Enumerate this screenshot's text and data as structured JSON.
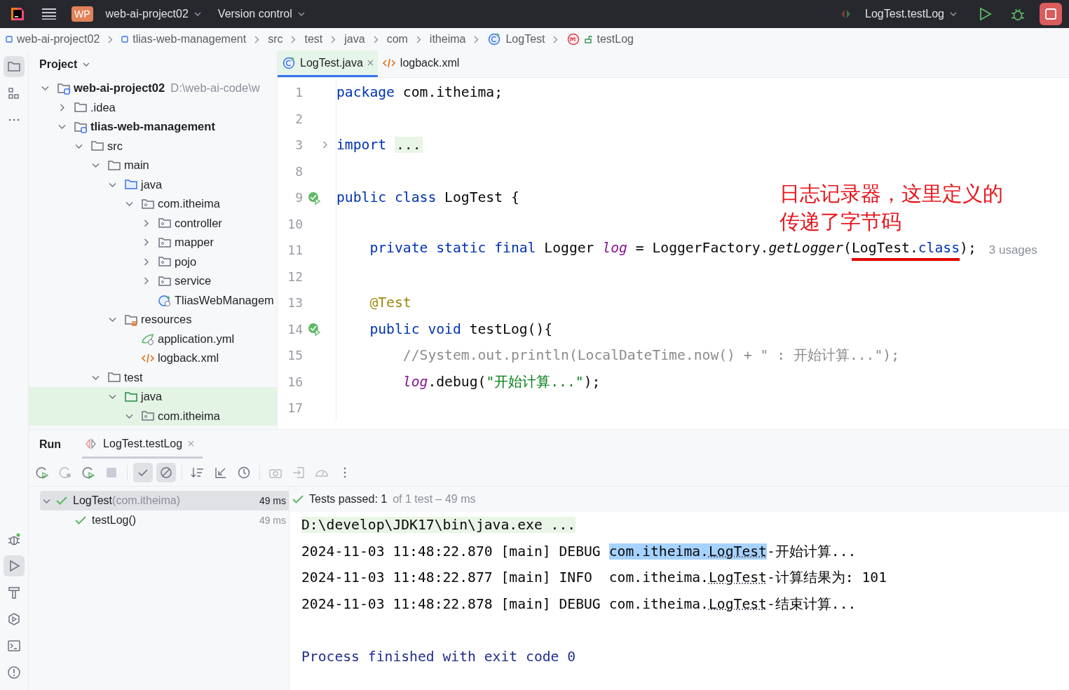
{
  "title_bar": {
    "project_badge": "WP",
    "project": "web-ai-project02",
    "vcs": "Version control",
    "run_config": "LogTest.testLog"
  },
  "breadcrumb": [
    {
      "label": "web-ai-project02",
      "kind": "module"
    },
    {
      "label": "tlias-web-management",
      "kind": "module"
    },
    {
      "label": "src",
      "kind": "plain"
    },
    {
      "label": "test",
      "kind": "plain"
    },
    {
      "label": "java",
      "kind": "plain"
    },
    {
      "label": "com",
      "kind": "plain"
    },
    {
      "label": "itheima",
      "kind": "plain"
    },
    {
      "label": "LogTest",
      "kind": "class"
    },
    {
      "label": "testLog",
      "kind": "method"
    }
  ],
  "project_panel": {
    "title": "Project",
    "tree": [
      {
        "label": "web-ai-project02",
        "hint": "D:\\web-ai-code\\w",
        "kind": "module",
        "bold": true,
        "expanded": true,
        "selected": false,
        "children": [
          {
            "label": ".idea",
            "kind": "folder",
            "bold": false,
            "expanded": false,
            "selected": false
          },
          {
            "label": "tlias-web-management",
            "kind": "module",
            "bold": true,
            "expanded": true,
            "selected": false,
            "children": [
              {
                "label": "src",
                "kind": "folder",
                "bold": false,
                "expanded": true,
                "selected": false,
                "children": [
                  {
                    "label": "main",
                    "kind": "folder",
                    "bold": false,
                    "expanded": true,
                    "selected": false,
                    "children": [
                      {
                        "label": "java",
                        "kind": "source",
                        "bold": false,
                        "expanded": true,
                        "selected": false,
                        "children": [
                          {
                            "label": "com.itheima",
                            "kind": "package",
                            "bold": false,
                            "expanded": true,
                            "selected": false,
                            "children": [
                              {
                                "label": "controller",
                                "kind": "package",
                                "bold": false,
                                "expanded": false,
                                "selected": false
                              },
                              {
                                "label": "mapper",
                                "kind": "package",
                                "bold": false,
                                "expanded": false,
                                "selected": false
                              },
                              {
                                "label": "pojo",
                                "kind": "package",
                                "bold": false,
                                "expanded": false,
                                "selected": false
                              },
                              {
                                "label": "service",
                                "kind": "package",
                                "bold": false,
                                "expanded": false,
                                "selected": false
                              },
                              {
                                "label": "TliasWebManagem",
                                "kind": "spring",
                                "bold": false,
                                "selected": false
                              }
                            ]
                          }
                        ]
                      },
                      {
                        "label": "resources",
                        "kind": "resources",
                        "bold": false,
                        "expanded": true,
                        "selected": false,
                        "children": [
                          {
                            "label": "application.yml",
                            "kind": "yml",
                            "bold": false,
                            "selected": false
                          },
                          {
                            "label": "logback.xml",
                            "kind": "xml",
                            "bold": false,
                            "selected": false
                          }
                        ]
                      }
                    ]
                  },
                  {
                    "label": "test",
                    "kind": "folder",
                    "bold": false,
                    "expanded": true,
                    "selected": false,
                    "children": [
                      {
                        "label": "java",
                        "kind": "testsource",
                        "bold": false,
                        "expanded": true,
                        "selected": true,
                        "children": [
                          {
                            "label": "com.itheima",
                            "kind": "package",
                            "bold": false,
                            "expanded": true,
                            "selected": true
                          }
                        ]
                      }
                    ]
                  }
                ]
              }
            ]
          }
        ]
      }
    ]
  },
  "editor": {
    "tabs": [
      {
        "label": "LogTest.java",
        "kind": "class",
        "selected": true,
        "closable": true
      },
      {
        "label": "logback.xml",
        "kind": "xml",
        "selected": false,
        "closable": false
      }
    ],
    "lines": [
      {
        "number": "1",
        "tokens": [
          {
            "kind": "keyword",
            "text": "package"
          },
          {
            "kind": "plain",
            "text": " com.itheima;"
          }
        ]
      },
      {
        "number": "2"
      },
      {
        "number": "3",
        "fold": true,
        "tokens": [
          {
            "kind": "keyword",
            "text": "import "
          },
          {
            "kind": "folded",
            "text": "..."
          }
        ]
      },
      {
        "number": "8"
      },
      {
        "number": "9",
        "run": true,
        "tokens": [
          {
            "kind": "keyword",
            "text": "public class"
          },
          {
            "kind": "plain",
            "text": " LogTest {"
          }
        ]
      },
      {
        "number": "10"
      },
      {
        "number": "11",
        "hint": "3 usages",
        "tokens": [
          {
            "kind": "keyword",
            "text": "    private static final"
          },
          {
            "kind": "plain",
            "text": " Logger "
          },
          {
            "kind": "field",
            "text": "log"
          },
          {
            "kind": "plain",
            "text": " = LoggerFactory."
          },
          {
            "kind": "static-call",
            "text": "getLogger"
          },
          {
            "kind": "plain",
            "text": "("
          },
          {
            "kind": "plain",
            "text": "LogTest",
            "underline": true
          },
          {
            "kind": "plain",
            "text": ".",
            "underline": true
          },
          {
            "kind": "keyword",
            "text": "class",
            "underline": true
          },
          {
            "kind": "plain",
            "text": ");"
          }
        ]
      },
      {
        "number": "12"
      },
      {
        "number": "13",
        "tokens": [
          {
            "kind": "annotation",
            "text": "    @Test"
          }
        ]
      },
      {
        "number": "14",
        "run": true,
        "tokens": [
          {
            "kind": "keyword",
            "text": "    public void"
          },
          {
            "kind": "plain",
            "text": " testLog(){"
          }
        ]
      },
      {
        "number": "15",
        "tokens": [
          {
            "kind": "comment",
            "text": "        //System.out.println(LocalDateTime.now() + \" : 开始计算...\");"
          }
        ]
      },
      {
        "number": "16",
        "tokens": [
          {
            "kind": "field",
            "text": "        log"
          },
          {
            "kind": "plain",
            "text": ".debug("
          },
          {
            "kind": "string",
            "text": "\"开始计算...\""
          },
          {
            "kind": "plain",
            "text": ");"
          }
        ]
      },
      {
        "number": "17"
      }
    ],
    "note": [
      "日志记录器，这里定义的",
      "传递了字节码"
    ]
  },
  "run_panel": {
    "title": "Run",
    "tabs": [
      {
        "label": "LogTest.testLog",
        "selected": true
      }
    ],
    "tests": [
      {
        "label": "LogTest",
        "package": "(com.itheima)",
        "time": "49 ms",
        "selected": true,
        "passed": true
      },
      {
        "label": "testLog()",
        "time": "49 ms",
        "selected": false,
        "passed": true
      }
    ],
    "status": {
      "main": "Tests passed: 1",
      "detail": "of 1 test – 49 ms"
    },
    "console": [
      {
        "kind": "command",
        "text": "D:\\develop\\JDK17\\bin\\java.exe ..."
      },
      {
        "kind": "log",
        "prefix": "2024-11-03 11:48:22.870 [main] DEBUG",
        "package": "com.itheima.",
        "class": "LogTest",
        "message": "-开始计算...",
        "selected": true
      },
      {
        "kind": "log",
        "prefix": "2024-11-03 11:48:22.877 [main] INFO ",
        "package": "com.itheima.",
        "class": "LogTest",
        "message": "-计算结果为: 101",
        "selected": false
      },
      {
        "kind": "log",
        "prefix": "2024-11-03 11:48:22.878 [main] DEBUG",
        "package": "com.itheima.",
        "class": "LogTest",
        "message": "-结束计算...",
        "selected": false
      },
      {
        "kind": "blank"
      },
      {
        "kind": "exit",
        "text": "Process finished with exit code 0"
      }
    ]
  },
  "tool_strip": {
    "top": [
      {
        "kind": "folder",
        "selected": true
      },
      {
        "kind": "structure",
        "selected": false
      },
      {
        "kind": "more",
        "selected": false
      }
    ],
    "bottom": [
      {
        "kind": "debug",
        "selected": false
      },
      {
        "kind": "run",
        "selected": true
      },
      {
        "kind": "build",
        "selected": false
      },
      {
        "kind": "services",
        "selected": false
      },
      {
        "kind": "terminal",
        "selected": false
      },
      {
        "kind": "problems",
        "selected": false
      }
    ]
  }
}
